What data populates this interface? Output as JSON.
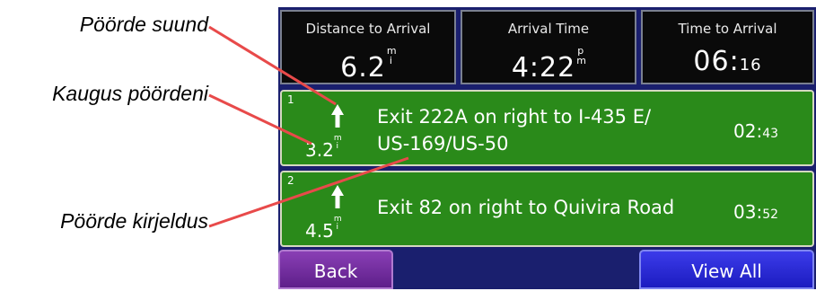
{
  "annotations": {
    "turn_direction": "Pöörde suund",
    "distance_to_turn": "Kaugus pöördeni",
    "turn_description": "Pöörde kirjeldus"
  },
  "trip_info": {
    "distance": {
      "label": "Distance to Arrival",
      "value": "6.2",
      "unit_top": "m",
      "unit_bottom": "i"
    },
    "arrival_time": {
      "label": "Arrival Time",
      "value": "4:22",
      "unit_top": "p",
      "unit_bottom": "m"
    },
    "time_to_arrival": {
      "label": "Time to Arrival",
      "value": "06:",
      "value_small": "16"
    }
  },
  "turns": [
    {
      "index": "1",
      "icon": "arrow-up-icon",
      "distance": "3.2",
      "unit_top": "m",
      "unit_bottom": "i",
      "line1": "Exit 222A on right to I-435 E/",
      "line2": "US-169/US-50",
      "time": "02:",
      "time_small": "43"
    },
    {
      "index": "2",
      "icon": "arrow-up-icon",
      "distance": "4.5",
      "unit_top": "m",
      "unit_bottom": "i",
      "line1": "Exit 82 on right to Quivira Road",
      "time": "03:",
      "time_small": "52"
    }
  ],
  "buttons": {
    "back": "Back",
    "view_all": "View All"
  },
  "colors": {
    "annotation_line": "#e84a4a",
    "turn_bg": "#2a8a1a",
    "info_bg": "#0a0a0a",
    "back_btn": "#7a32a8",
    "view_all_btn": "#2b2bd8",
    "frame": "#1a1f6e"
  }
}
